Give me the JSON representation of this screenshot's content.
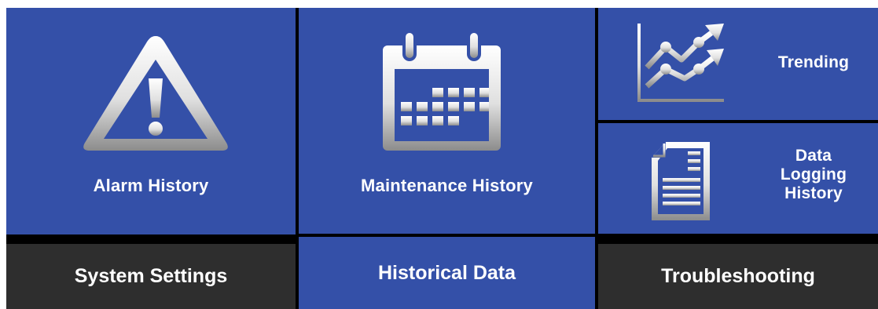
{
  "tiles": {
    "alarm_history": {
      "label": "Alarm History",
      "icon": "warning-icon"
    },
    "maintenance_history": {
      "label": "Maintenance History",
      "icon": "calendar-icon"
    },
    "trending": {
      "label": "Trending",
      "icon": "trend-chart-icon"
    },
    "data_logging_history": {
      "label_line1": "Data",
      "label_line2": "Logging",
      "label_line3": "History",
      "icon": "document-icon"
    }
  },
  "nav": {
    "system_settings": "System Settings",
    "historical_data": "Historical Data",
    "troubleshooting": "Troubleshooting"
  },
  "colors": {
    "tile_blue": "#3450a8",
    "nav_dark": "#2e2e2e",
    "separator": "#000000",
    "text": "#ffffff"
  }
}
